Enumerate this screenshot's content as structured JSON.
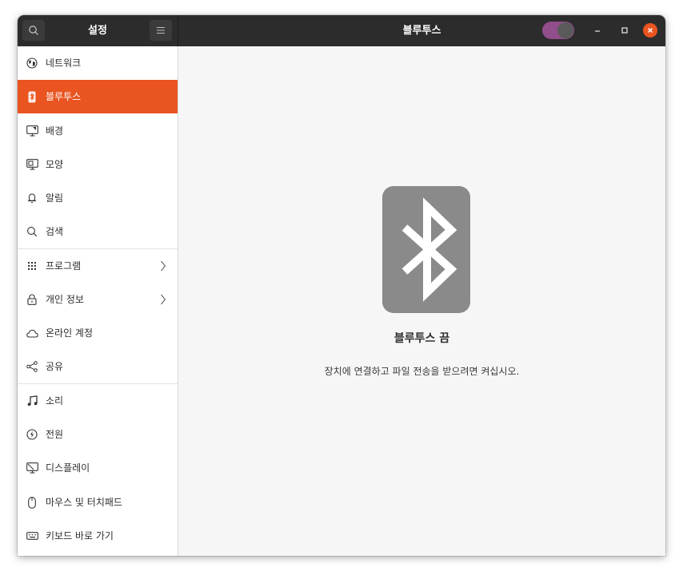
{
  "header": {
    "sidebar_title": "설정",
    "panel_title": "블루투스",
    "bluetooth_toggle": "off"
  },
  "sidebar": {
    "items": [
      {
        "label": "네트워크",
        "icon": "network-icon"
      },
      {
        "label": "블루투스",
        "icon": "bluetooth-icon",
        "active": true
      },
      {
        "label": "배경",
        "icon": "background-icon"
      },
      {
        "label": "모양",
        "icon": "appearance-icon"
      },
      {
        "label": "알림",
        "icon": "bell-icon"
      },
      {
        "label": "검색",
        "icon": "search-icon"
      },
      {
        "label": "프로그램",
        "icon": "apps-grid-icon",
        "has_submenu": true
      },
      {
        "label": "개인 정보",
        "icon": "lock-icon",
        "has_submenu": true
      },
      {
        "label": "온라인 계정",
        "icon": "cloud-icon"
      },
      {
        "label": "공유",
        "icon": "share-icon"
      },
      {
        "label": "소리",
        "icon": "music-note-icon"
      },
      {
        "label": "전원",
        "icon": "power-icon"
      },
      {
        "label": "디스플레이",
        "icon": "display-icon"
      },
      {
        "label": "마우스 및 터치패드",
        "icon": "mouse-icon"
      },
      {
        "label": "키보드 바로 가기",
        "icon": "keyboard-icon"
      }
    ]
  },
  "main": {
    "status_title": "블루투스 끔",
    "status_description": "장치에 연결하고 파일 전송을 받으려면 켜십시오."
  },
  "colors": {
    "accent": "#e95420",
    "toggle": "#924d8b",
    "header_bg": "#2c2c2c"
  }
}
